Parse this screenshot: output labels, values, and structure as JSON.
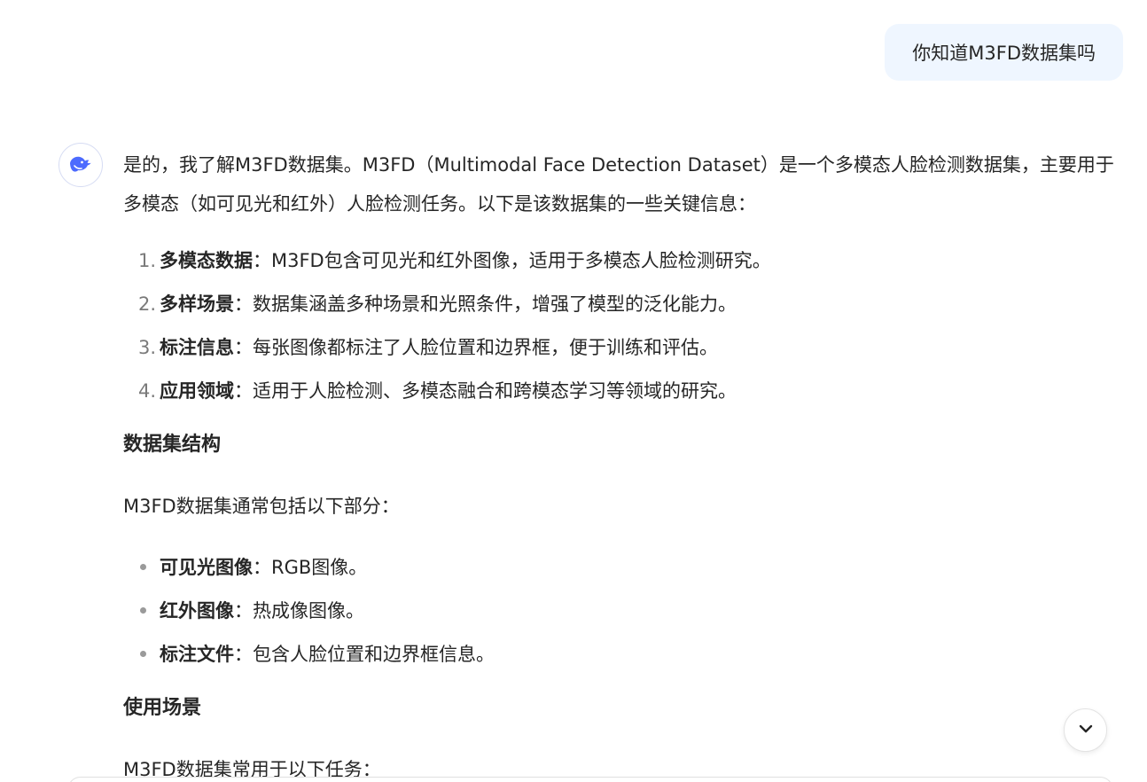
{
  "user_message": "你知道M3FD数据集吗",
  "answer": {
    "intro": "是的，我了解M3FD数据集。M3FD（Multimodal Face Detection Dataset）是一个多模态人脸检测数据集，主要用于多模态（如可见光和红外）人脸检测任务。以下是该数据集的一些关键信息：",
    "points": [
      {
        "num": "1.",
        "title": "多模态数据",
        "text": "：M3FD包含可见光和红外图像，适用于多模态人脸检测研究。"
      },
      {
        "num": "2.",
        "title": "多样场景",
        "text": "：数据集涵盖多种场景和光照条件，增强了模型的泛化能力。"
      },
      {
        "num": "3.",
        "title": "标注信息",
        "text": "：每张图像都标注了人脸位置和边界框，便于训练和评估。"
      },
      {
        "num": "4.",
        "title": "应用领域",
        "text": "：适用于人脸检测、多模态融合和跨模态学习等领域的研究。"
      }
    ],
    "structure_heading": "数据集结构",
    "structure_intro": "M3FD数据集通常包括以下部分：",
    "parts": [
      {
        "title": "可见光图像",
        "text": "：RGB图像。"
      },
      {
        "title": "红外图像",
        "text": "：热成像图像。"
      },
      {
        "title": "标注文件",
        "text": "：包含人脸位置和边界框信息。"
      }
    ],
    "usage_heading": "使用场景",
    "usage_intro": "M3FD数据集常用于以下任务："
  },
  "icons": {
    "avatar": "whale-logo-icon",
    "scroll": "chevron-down-icon"
  },
  "colors": {
    "user_bubble": "#eff6ff",
    "brand": "#4d6bfe"
  }
}
